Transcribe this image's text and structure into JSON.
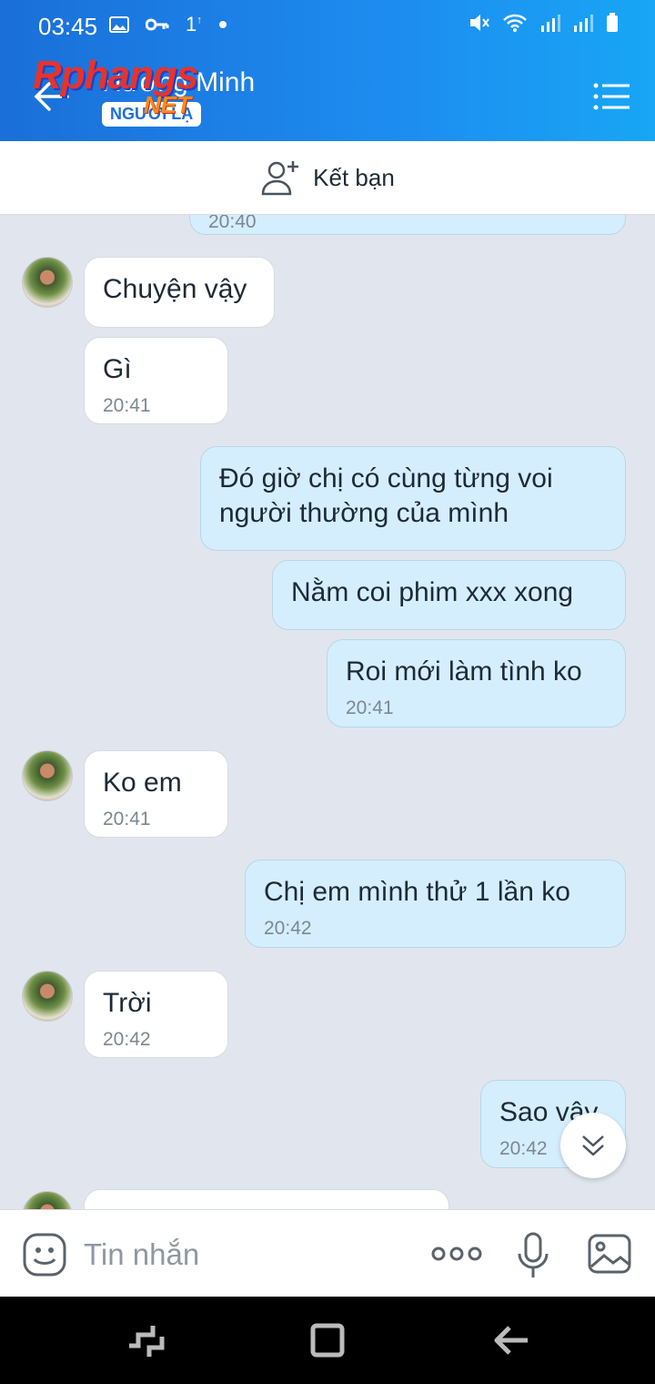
{
  "status_bar": {
    "time": "03:45",
    "left_icons": [
      "gallery-icon",
      "key-icon",
      "notification-icon"
    ],
    "notification_text": "1",
    "right_icons": [
      "mute-icon",
      "wifi-icon",
      "signal-icon",
      "battery-icon"
    ]
  },
  "header": {
    "contact_name": "Hương Minh",
    "badge": "NGƯỜI LẠ",
    "watermark": "Rphangs",
    "watermark_suffix": "NET",
    "colors": {
      "gradient_start": "#1a6fd8",
      "gradient_end": "#18a6f5"
    }
  },
  "add_friend": {
    "label": "Kết bạn"
  },
  "messages": [
    {
      "direction": "out",
      "text": "",
      "time": "20:40"
    },
    {
      "direction": "in",
      "text": "Chuyện vậy",
      "time": ""
    },
    {
      "direction": "in",
      "text": "Gì",
      "time": "20:41"
    },
    {
      "direction": "out",
      "text": "Đó  giờ  chị  có cùng từng  voi người  thường của  mình",
      "time": ""
    },
    {
      "direction": "out",
      "text": "Nằm  coi phim xxx xong",
      "time": ""
    },
    {
      "direction": "out",
      "text": "Roi mới làm  tình  ko",
      "time": "20:41"
    },
    {
      "direction": "in",
      "text": "Ko em",
      "time": "20:41"
    },
    {
      "direction": "out",
      "text": "Chị  em  mình  thử 1 lần ko",
      "time": "20:42"
    },
    {
      "direction": "in",
      "text": "Trời",
      "time": "20:42"
    },
    {
      "direction": "out",
      "text": "Sao vậy",
      "time": "20:42"
    },
    {
      "direction": "in",
      "text": "",
      "time": ""
    }
  ],
  "input_bar": {
    "placeholder": "Tin nhắn",
    "icons": [
      "emoji-icon",
      "more-icon",
      "microphone-icon",
      "image-icon"
    ]
  },
  "nav_bar": {
    "icons": [
      "recent-apps-icon",
      "home-icon",
      "back-icon"
    ]
  },
  "colors": {
    "chat_background": "#e1e6ee",
    "incoming_bubble": "#ffffff",
    "outgoing_bubble": "#d5eefd"
  }
}
